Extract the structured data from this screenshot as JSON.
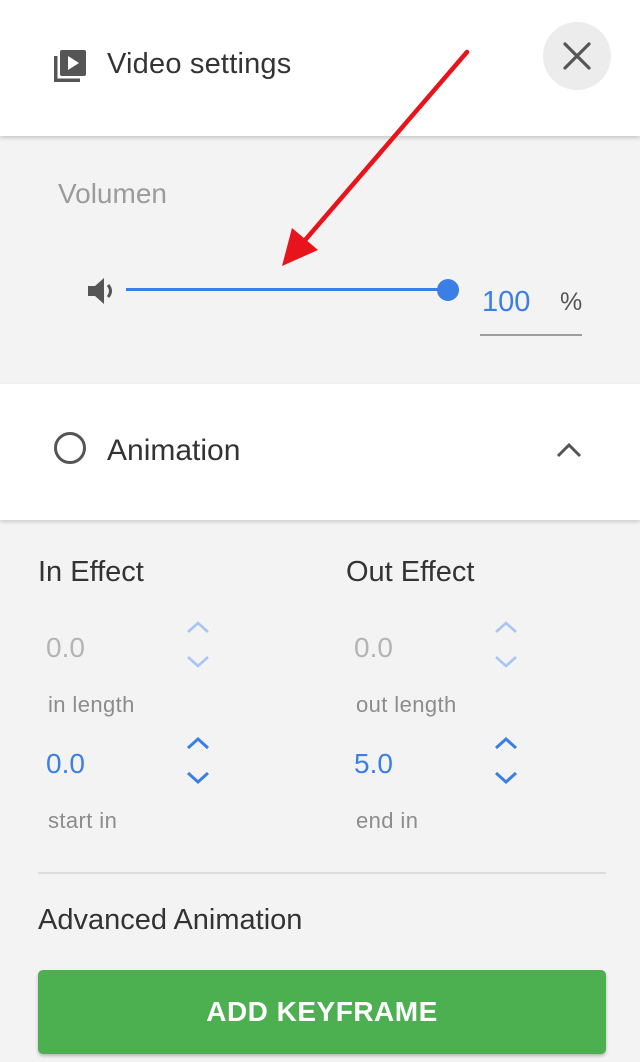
{
  "header": {
    "title": "Video settings"
  },
  "volume": {
    "label": "Volumen",
    "value": "100",
    "unit": "%",
    "level": 1.0
  },
  "animation": {
    "title": "Animation",
    "in_effect": {
      "title": "In Effect",
      "length_value": "0.0",
      "length_label": "in length",
      "start_value": "0.0",
      "start_label": "start in"
    },
    "out_effect": {
      "title": "Out Effect",
      "length_value": "0.0",
      "length_label": "out length",
      "end_value": "5.0",
      "end_label": "end in"
    },
    "advanced_title": "Advanced Animation",
    "add_keyframe_label": "ADD KEYFRAME"
  },
  "colors": {
    "accent": "#3b7fe6",
    "button_green": "#4caf50",
    "annotation_arrow": "#e8141b"
  },
  "icons": [
    "video-library-icon",
    "close-icon",
    "speaker-icon",
    "radio-unchecked-icon",
    "chevron-up-icon",
    "chevron-up-icon",
    "chevron-down-icon"
  ]
}
